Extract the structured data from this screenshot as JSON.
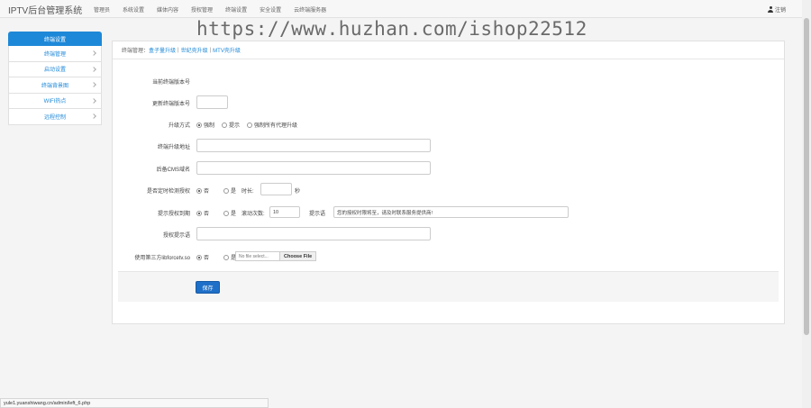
{
  "app": {
    "title": "IPTV后台管理系统",
    "logout": "注销"
  },
  "nav": [
    "管理员",
    "系统设置",
    "媒体内容",
    "授权管理",
    "终端设置",
    "安全设置",
    "云终端服务器"
  ],
  "watermark": "https://www.huzhan.com/ishop22512",
  "sidebar": {
    "header": "终端设置",
    "items": [
      "终端管理",
      "启动设置",
      "终端背景图",
      "WIFI热点",
      "远程控制"
    ]
  },
  "breadcrumb": {
    "label": "终端管理：",
    "links": [
      "盒子量升级",
      "世纪壳升级",
      "MTV壳升级"
    ]
  },
  "form": {
    "current_version_label": "当前终端版本号",
    "update_version_label": "更新终端版本号",
    "update_version_value": "",
    "upgrade_mode_label": "升级方式",
    "upgrade_options": [
      "强制",
      "提示",
      "强制所有代理升级"
    ],
    "upgrade_address_label": "终端升级地址",
    "upgrade_address_value": "",
    "cms_domain_label": "后备CMS域名",
    "cms_domain_value": "",
    "check_auth_label": "是否定时检测授权",
    "yes_no": [
      "否",
      "是"
    ],
    "duration_label": "时长:",
    "duration_value": "",
    "seconds_unit": "秒",
    "expire_prompt_label": "提示授权到期",
    "scroll_count_label": "滚动次数:",
    "scroll_count_value": "10",
    "prompt_text_label": "提示语",
    "prompt_text_value": "您的授权时限将至，请及时联系服务提供商!",
    "auth_prompt_label": "授权提示语",
    "auth_prompt_value": "",
    "third_party_label": "使用第三方libforcetv.so",
    "file_placeholder": "No file select...",
    "file_button": "Choose File",
    "save": "保存"
  },
  "status_bar": "yule1.yuanshiwang.cn/admin/left_6.php"
}
